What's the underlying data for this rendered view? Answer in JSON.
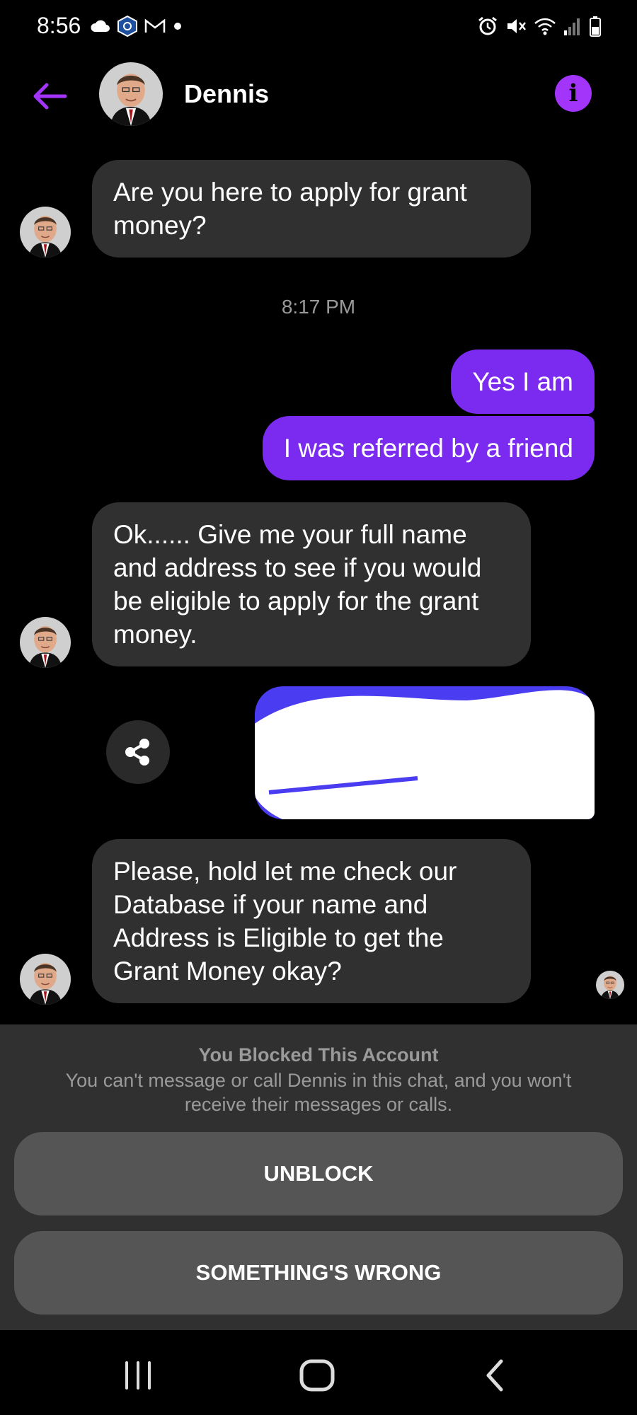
{
  "status_bar": {
    "time": "8:56",
    "left_icons": [
      "cloud-icon",
      "crypto-icon",
      "gmail-icon",
      "dot-icon"
    ],
    "right_icons": [
      "alarm-icon",
      "mute-icon",
      "wifi-icon",
      "signal-icon",
      "battery-icon"
    ]
  },
  "header": {
    "contact_name": "Dennis",
    "info_label": "i"
  },
  "messages": [
    {
      "direction": "in",
      "text": "Are you here to apply for grant money?"
    },
    {
      "direction": "out",
      "text": "Yes I am"
    },
    {
      "direction": "out",
      "text": "I was referred by a friend"
    },
    {
      "direction": "in",
      "text": "Ok...... Give me your full name and address to see if you would be eligible to apply for the grant money."
    },
    {
      "direction": "in",
      "text": "Please, hold let me check our Database if your name and Address is Eligible to get the Grant Money okay?"
    }
  ],
  "timestamp": "8:17 PM",
  "blocked": {
    "title": "You Blocked This Account",
    "description": "You can't message or call Dennis in this chat, and you won't receive their messages or calls.",
    "unblock_label": "UNBLOCK",
    "wrong_label": "SOMETHING'S WRONG"
  },
  "colors": {
    "accent": "#a334fa",
    "outgoing_bubble": "#7b2bf0",
    "incoming_bubble": "#303030",
    "panel": "#303030",
    "panel_button": "#555555"
  }
}
